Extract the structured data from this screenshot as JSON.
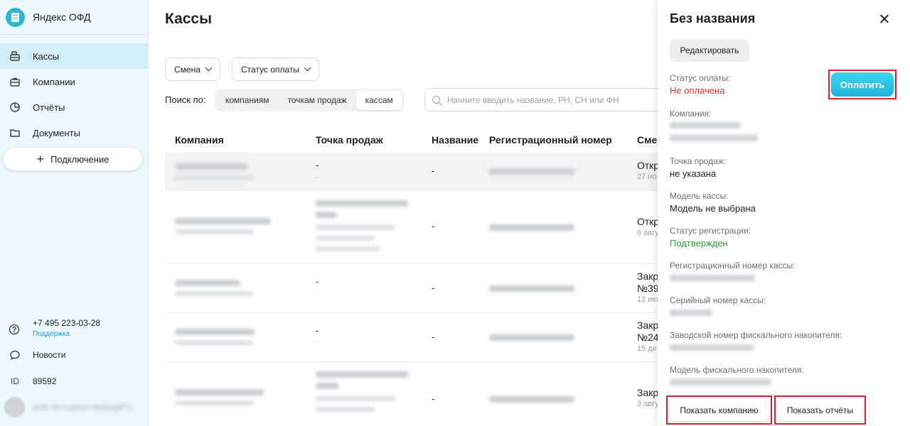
{
  "app": {
    "name": "Яндекс ОФД"
  },
  "sidebar": {
    "items": [
      {
        "label": "Кассы",
        "icon": "cash-register-icon",
        "active": true
      },
      {
        "label": "Компании",
        "icon": "briefcase-icon",
        "active": false
      },
      {
        "label": "Отчёты",
        "icon": "pie-chart-icon",
        "active": false
      },
      {
        "label": "Документы",
        "icon": "folder-icon",
        "active": false
      }
    ],
    "connect_label": "Подключение",
    "support_phone": "+7 495 223-03-28",
    "support_link": "Поддержка",
    "news_label": "Новости",
    "id_prefix": "ID",
    "id_value": "89592",
    "user_email": "yndx-for-support-ekdsayj8Tn"
  },
  "main": {
    "title": "Кассы",
    "filters": {
      "smena": "Смена",
      "pay_status": "Статус оплаты"
    },
    "search_label": "Поиск по:",
    "search_tabs": [
      "компаниям",
      "точкам продаж",
      "кассам"
    ],
    "search_selected": "кассам",
    "search_placeholder": "Начните вводить название, РН, СН или ФН",
    "columns": [
      "Компания",
      "Точка продаж",
      "Название",
      "Регистрационный номер",
      "Смена"
    ],
    "rows": [
      {
        "company": "ИП Мах Вах Хай",
        "point": "-",
        "point_sub": "-",
        "name": "-",
        "regnum": "0005235437036786",
        "smena": "Откр",
        "smena_sub": "27 но"
      },
      {
        "company": "ИП Нгуен Ван Ньюинг",
        "point": "ТТ Павильон \"Отдел",
        "point_sub": "ул. Москвитина",
        "name": "-",
        "regnum": "0005235613028539",
        "smena": "Откр",
        "smena_sub": "6 авгу"
      },
      {
        "company": "ИП Тан Цинан",
        "point": "-",
        "point_sub": "-",
        "name": "-",
        "regnum": "0007125049911902",
        "smena": "Закр",
        "smena_line2": "№39",
        "smena_sub": "12 ию"
      },
      {
        "company": "ИП Дона Ван Лай",
        "point": "-",
        "point_sub": "-",
        "name": "-",
        "regnum": "0005237932063113",
        "smena": "Закр",
        "smena_line2": "№24",
        "smena_sub": "15 де"
      },
      {
        "company": "ИП Дуат Тхань Хань",
        "point": "Павильон №5 \"отдел",
        "point_sub": "ул. Москвитина",
        "name": "-",
        "regnum": "0005237861054531",
        "smena": "Закр",
        "smena_sub": "3 авгу"
      }
    ]
  },
  "panel": {
    "title": "Без названия",
    "edit_label": "Редактировать",
    "pay_label": "Оплатить",
    "fields": {
      "pay_status_label": "Статус оплаты:",
      "pay_status_value": "Не оплачена",
      "company_label": "Компания:",
      "company_value": "ИП Мах Вах Хай",
      "point_label": "Точка продаж:",
      "point_value": "не указана",
      "model_label": "Модель кассы:",
      "model_value": "Модель не выбрана",
      "reg_status_label": "Статус регистрации:",
      "reg_status_value": "Подтвержден",
      "reg_num_label": "Регистрационный номер кассы:",
      "reg_num_value": "0005235437036786",
      "serial_label": "Серийный номер кассы:",
      "serial_value": "00224888",
      "fn_num_label": "Заводской номер фискального накопителя:",
      "fn_num_value": "7289440391343052",
      "fn_model_label": "Модель фискального накопителя:",
      "fn_model_value": "ФН-1.1 исполнение Ав15-2"
    },
    "show_company_label": "Показать компанию",
    "show_reports_label": "Показать отчёты"
  },
  "colors": {
    "accent": "#2ab7d9",
    "unpaid": "#e8332a",
    "confirmed": "#2ba43a",
    "highlight_border": "#d9242f"
  }
}
